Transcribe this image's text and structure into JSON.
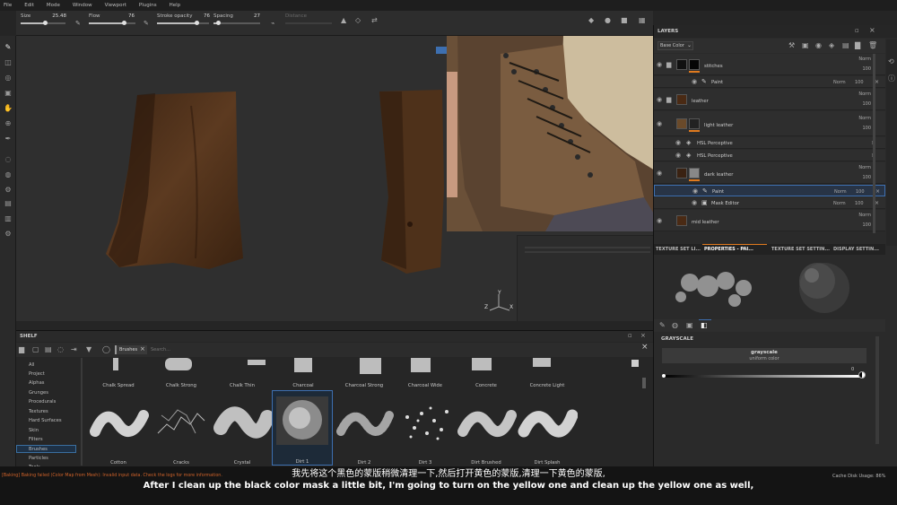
{
  "menu": [
    "File",
    "Edit",
    "Mode",
    "Window",
    "Viewport",
    "Plugins",
    "Help"
  ],
  "tool_options": {
    "size_label": "Size",
    "size_value": "25.48",
    "size_frac": 0.55,
    "flow_label": "Flow",
    "flow_value": "76",
    "flow_frac": 0.76,
    "stroke_label": "Stroke opacity",
    "stroke_value": "76",
    "stroke_frac": 0.76,
    "spacing_label": "Spacing",
    "spacing_value": "27",
    "spacing_frac": 0.1,
    "distance_label": "Distance"
  },
  "layers": {
    "title": "LAYERS",
    "channel": "Base Color",
    "rows": [
      {
        "name": "stitches",
        "blend": "Norm",
        "opacity": "100"
      },
      {
        "name": "Paint",
        "blend": "Norm",
        "opacity": "100"
      },
      {
        "name": "leather",
        "blend": "Norm",
        "opacity": "100"
      },
      {
        "name": "light leather",
        "blend": "Norm",
        "opacity": "100"
      },
      {
        "name": "HSL Perceptive"
      },
      {
        "name": "HSL Perceptive"
      },
      {
        "name": "dark leather",
        "blend": "Norm",
        "opacity": "100"
      },
      {
        "name": "Paint",
        "blend": "Norm",
        "opacity": "100"
      },
      {
        "name": "Mask Editor",
        "blend": "Norm",
        "opacity": "100"
      },
      {
        "name": "mid leather",
        "blend": "Norm",
        "opacity": "100"
      }
    ]
  },
  "tabs": [
    "TEXTURE SET LI...",
    "PROPERTIES - PAI...",
    "TEXTURE SET SETTIN...",
    "DISPLAY SETTIN..."
  ],
  "grayscale": {
    "title": "GRAYSCALE",
    "box_title": "grayscale",
    "box_sub": "uniform color",
    "value": "0"
  },
  "shelf": {
    "title": "SHELF",
    "filter_tag": "Brushes",
    "search_placeholder": "Search...",
    "categories": [
      "All",
      "Project",
      "Alphas",
      "Grunges",
      "Procedurals",
      "Textures",
      "Hard Surfaces",
      "Skin",
      "Filters",
      "Brushes",
      "Particles",
      "Tools"
    ],
    "selected_category": "Brushes",
    "top_row": [
      "Chalk Spread",
      "Chalk Strong",
      "Chalk Thin",
      "Charcoal",
      "Charcoal Strong",
      "Charcoal Wide",
      "Concrete",
      "Concrete Light"
    ],
    "bottom_row": [
      "Cotton",
      "Cracks",
      "Crystal",
      "Dirt 1",
      "Dirt 2",
      "Dirt 3",
      "Dirt Brushed",
      "Dirt Splash"
    ],
    "selected_brush": "Dirt 1"
  },
  "status": {
    "error": "[Baking] Baking failed (Color Map from Mesh): Invalid input data. Check the logs for more information.",
    "right": "Cache Disk Usage:   86%"
  },
  "subtitles": {
    "cn": "我先将这个黑色的蒙版稍微清理一下,然后打开黄色的蒙版,清理一下黄色的蒙版,",
    "en": "After I clean up the black color mask a little bit, I'm going to turn on the yellow one and clean up the yellow one as well,"
  },
  "axis": {
    "x": "X",
    "y": "Y",
    "z": "Z"
  }
}
